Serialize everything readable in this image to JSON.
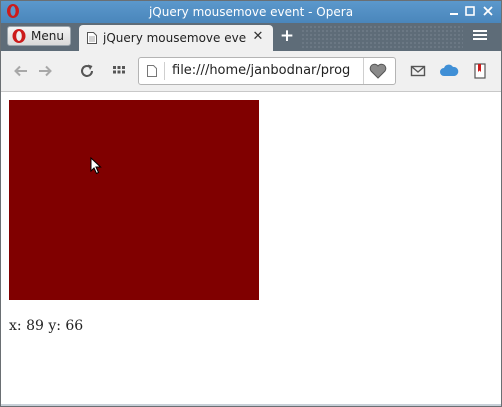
{
  "window": {
    "title": "jQuery mousemove event - Opera"
  },
  "tabstrip": {
    "menu_label": "Menu",
    "tabs": [
      {
        "title": "jQuery mousemove event",
        "active": true
      }
    ]
  },
  "toolbar": {
    "url": "file:///home/janbodnar/prog"
  },
  "page": {
    "box_color": "#800000",
    "coords_text": "x: 89 y: 66"
  },
  "icons": {
    "titlebar": [
      "opera-logo-icon",
      "minimize-icon",
      "maximize-icon",
      "close-icon"
    ],
    "tabstrip": [
      "opera-logo-icon",
      "page-icon",
      "tab-close-icon",
      "new-tab-icon",
      "tab-menu-icon"
    ],
    "toolbar": [
      "back-icon",
      "forward-icon",
      "reload-icon",
      "speed-dial-icon",
      "page-icon",
      "heart-icon",
      "mail-icon",
      "cloud-icon",
      "bookmark-icon"
    ],
    "page": [
      "mouse-cursor-icon"
    ]
  }
}
